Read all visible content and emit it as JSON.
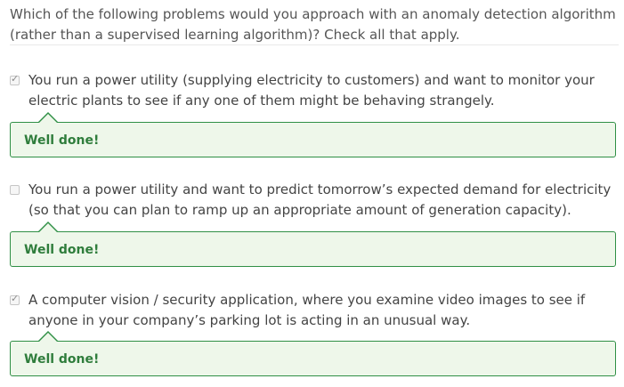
{
  "question": "Which of the following problems would you approach with an anomaly detection algorithm (rather than a supervised learning algorithm)? Check all that apply.",
  "options": [
    {
      "label": "You run a power utility (supplying electricity to customers) and want to monitor your electric plants to see if any one of them might be behaving strangely.",
      "checked": true,
      "feedback": "Well done!"
    },
    {
      "label": "You run a power utility and want to predict tomorrow’s expected demand for electricity (so that you can plan to ramp up an appropriate amount of generation capacity).",
      "checked": false,
      "feedback": "Well done!"
    },
    {
      "label": "A computer vision / security application, where you examine video images to see if anyone in your company’s parking lot is acting in an unusual way.",
      "checked": true,
      "feedback": "Well done!"
    }
  ],
  "colors": {
    "feedback_border": "#2f8f45",
    "feedback_background": "#eef7ea",
    "feedback_text": "#2f7d3c"
  }
}
